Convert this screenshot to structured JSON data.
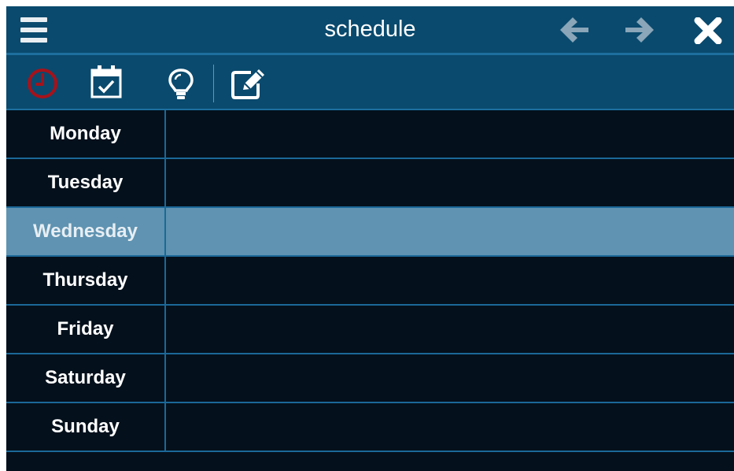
{
  "header": {
    "title": "schedule",
    "menu_icon": "hamburger-menu-icon",
    "back_icon": "arrow-left-icon",
    "forward_icon": "arrow-right-icon",
    "close_icon": "close-icon"
  },
  "toolbar": {
    "items": [
      {
        "icon": "clock-icon",
        "active": true
      },
      {
        "icon": "calendar-check-icon",
        "active": false
      },
      {
        "icon": "lightbulb-icon",
        "active": false
      },
      {
        "icon": "edit-icon",
        "active": false
      }
    ]
  },
  "schedule": {
    "days": [
      {
        "label": "Monday",
        "selected": false
      },
      {
        "label": "Tuesday",
        "selected": false
      },
      {
        "label": "Wednesday",
        "selected": true
      },
      {
        "label": "Thursday",
        "selected": false
      },
      {
        "label": "Friday",
        "selected": false
      },
      {
        "label": "Saturday",
        "selected": false
      },
      {
        "label": "Sunday",
        "selected": false
      }
    ]
  },
  "colors": {
    "header_bg": "#0a4a6e",
    "body_bg": "#04101c",
    "selected_row": "#5f93b1",
    "row_border": "#1b6898",
    "clock_red": "#a6121a",
    "nav_arrow_disabled": "#8aa6b8"
  }
}
